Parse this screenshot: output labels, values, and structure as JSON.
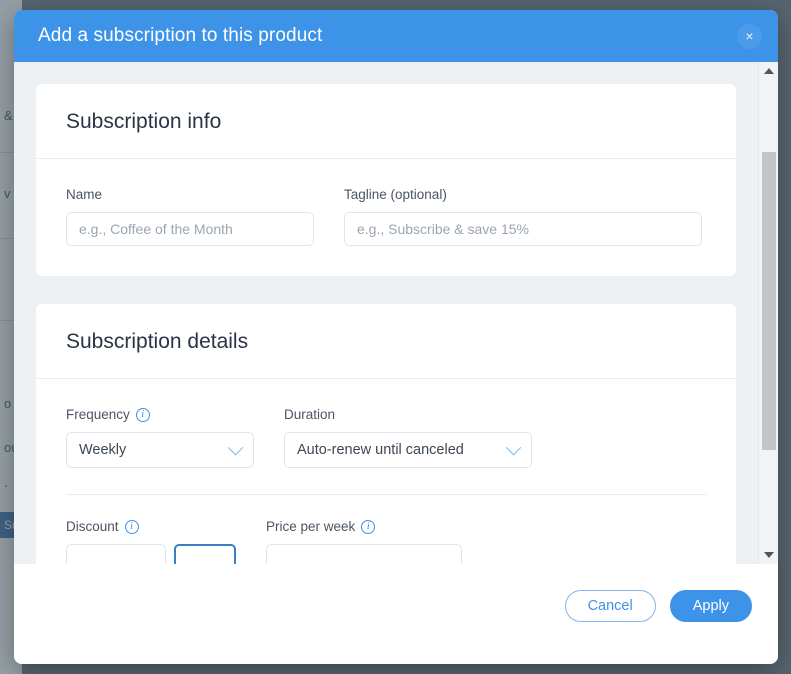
{
  "backdrop": {
    "page_fragments": [
      "&",
      "v",
      "o",
      "ou",
      "·"
    ],
    "page_button_label": "Su"
  },
  "modal": {
    "title": "Add a subscription to this product",
    "close_icon": "×",
    "header_color": "#3d93e8",
    "sections": [
      {
        "title": "Subscription info",
        "fields": [
          {
            "label": "Name",
            "value": "",
            "placeholder": "e.g., Coffee of the Month",
            "has_info": false
          },
          {
            "label": "Tagline (optional)",
            "value": "",
            "placeholder": "e.g., Subscribe & save 15%",
            "has_info": false
          }
        ]
      },
      {
        "title": "Subscription details",
        "fields": [
          {
            "label": "Frequency",
            "value": "Weekly",
            "has_info": true
          },
          {
            "label": "Duration",
            "value": "Auto-renew until canceled",
            "has_info": true
          },
          {
            "label": "Discount",
            "value": "",
            "has_info": true
          },
          {
            "label": "Price per week",
            "value": "",
            "has_info": true
          }
        ]
      }
    ],
    "footer": {
      "cancel_label": "Cancel",
      "apply_label": "Apply",
      "apply_color": "#3d93e8"
    },
    "scrollbar": {
      "up_arrow": "▲",
      "down_arrow": "▼"
    }
  }
}
